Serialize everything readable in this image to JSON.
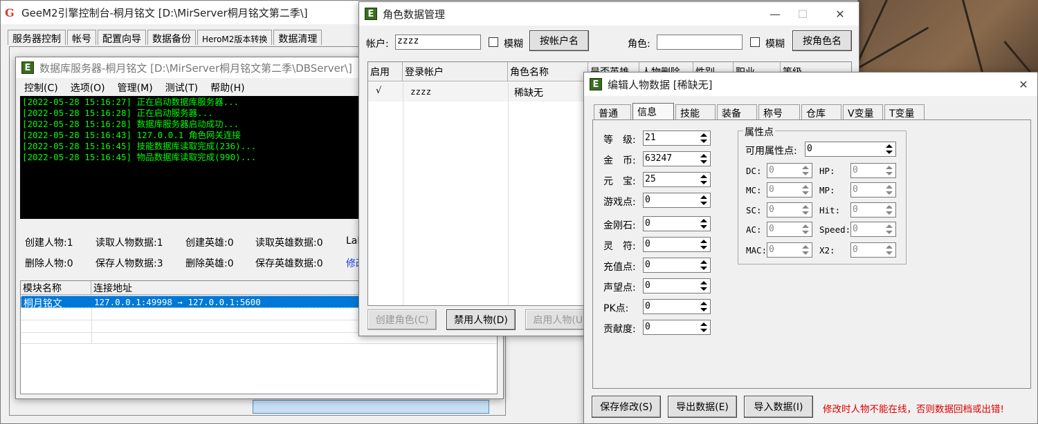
{
  "geem": {
    "title": "GeeM2引擎控制台-桐月铭文 [D:\\MirServer桐月铭文第二季\\]",
    "tabs": [
      "服务器控制",
      "帐号",
      "配置向导",
      "数据备份",
      "HeroM2版本转换",
      "数据清理"
    ]
  },
  "db": {
    "title": "数据库服务器-桐月铭文 [D:\\MirServer桐月铭文第二季\\DBServer\\]",
    "menu": [
      "控制(C)",
      "选项(O)",
      "管理(M)",
      "测试(T)",
      "帮助(H)"
    ],
    "log": [
      "[2022-05-28 15:16:27] 正在启动数据库服务器...",
      "[2022-05-28 15:16:28] 正在启动服务器...",
      "[2022-05-28 15:16:28] 数据库服务器启动成功...",
      "[2022-05-28 15:16:43] 127.0.0.1 角色网关连接",
      "[2022-05-28 15:16:45] 技能数据库读取完成(236)...",
      "[2022-05-28 15:16:45] 物品数据库读取完成(990)..."
    ],
    "stats_row1": [
      "创建人物:1",
      "读取人物数据:1",
      "创建英雄:0",
      "读取英雄数据:0",
      "Lal"
    ],
    "stats_row2": [
      "删除人物:0",
      "保存人物数据:3",
      "删除英雄:0",
      "保存英雄数据:0",
      "修改"
    ],
    "table_headers": [
      "模块名称",
      "连接地址"
    ],
    "table_row": {
      "name": "桐月铭文",
      "addr": "127.0.0.1:49998 → 127.0.0.1:5600"
    }
  },
  "role": {
    "title": "角色数据管理",
    "account_label": "帐户:",
    "account_value": "zzzz",
    "fuzzy_label": "模糊",
    "by_account_btn": "按帐户名",
    "role_label": "角色:",
    "role_value": "",
    "fuzzy_label2": "模糊",
    "by_role_btn": "按角色名",
    "headers": [
      "启用",
      "登录帐户",
      "角色名称",
      "是否英雄",
      "人物删除",
      "性别",
      "职业",
      "等级"
    ],
    "row": {
      "enabled": "√",
      "account": "zzzz",
      "name": "稀缺无"
    },
    "btn_create": "创建角色(C)",
    "btn_disable": "禁用人物(D)",
    "btn_enable": "启用人物(U)"
  },
  "edit": {
    "title": "编辑人物数据 [稀缺无]",
    "tabs": [
      "普通",
      "信息",
      "技能",
      "装备",
      "称号",
      "仓库",
      "V变量",
      "T变量"
    ],
    "active_tab": "信息",
    "fields": [
      {
        "label": "等　级:",
        "value": "21"
      },
      {
        "label": "金　币:",
        "value": "63247"
      },
      {
        "label": "元　宝:",
        "value": "25"
      },
      {
        "label": "游戏点:",
        "value": "0"
      },
      {
        "label": "金刚石:",
        "value": "0"
      },
      {
        "label": "灵　符:",
        "value": "0"
      },
      {
        "label": "充值点:",
        "value": "0"
      },
      {
        "label": "声望点:",
        "value": "0"
      },
      {
        "label": "PK点:",
        "value": "0"
      },
      {
        "label": "贡献度:",
        "value": "0"
      }
    ],
    "attr_group": "属性点",
    "avail_label": "可用属性点:",
    "avail_value": "0",
    "attrs_left": [
      {
        "label": "DC:",
        "value": "0"
      },
      {
        "label": "MC:",
        "value": "0"
      },
      {
        "label": "SC:",
        "value": "0"
      },
      {
        "label": "AC:",
        "value": "0"
      },
      {
        "label": "MAC:",
        "value": "0"
      }
    ],
    "attrs_right": [
      {
        "label": "HP:",
        "value": "0"
      },
      {
        "label": "MP:",
        "value": "0"
      },
      {
        "label": "Hit:",
        "value": "0"
      },
      {
        "label": "Speed:",
        "value": "0"
      },
      {
        "label": "X2:",
        "value": "0"
      }
    ],
    "btn_save": "保存修改(S)",
    "btn_export": "导出数据(E)",
    "btn_import": "导入数据(I)",
    "warning": "修改时人物不能在线，否则数据回档或出错!",
    "warning_color": "#e00000"
  }
}
